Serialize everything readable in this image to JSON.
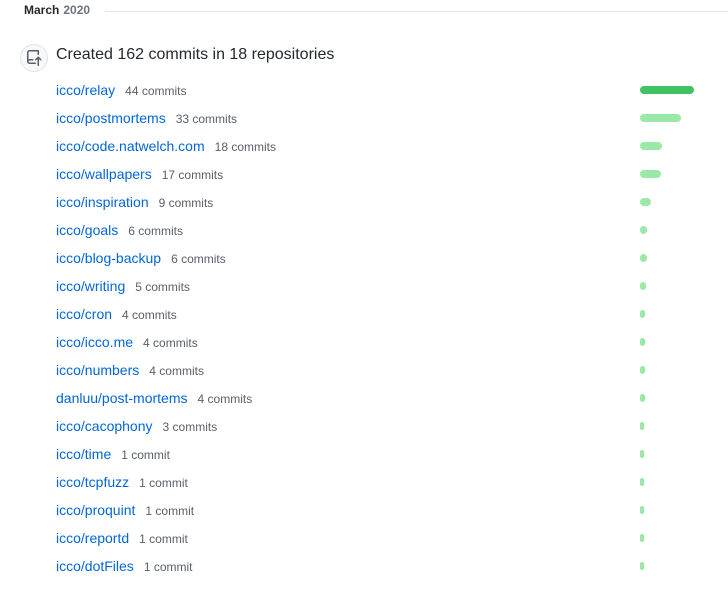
{
  "header": {
    "month": "March",
    "year": "2020"
  },
  "summary": "Created 162 commits in 18 repositories",
  "maxCommits": 44,
  "colors": {
    "high": "#40c463",
    "mid": "#9be9a8",
    "low": "#9be9a8"
  },
  "repos": [
    {
      "name": "icco/relay",
      "commits": 44,
      "label": "44 commits",
      "color": "#40c463"
    },
    {
      "name": "icco/postmortems",
      "commits": 33,
      "label": "33 commits",
      "color": "#9be9a8"
    },
    {
      "name": "icco/code.natwelch.com",
      "commits": 18,
      "label": "18 commits",
      "color": "#9be9a8"
    },
    {
      "name": "icco/wallpapers",
      "commits": 17,
      "label": "17 commits",
      "color": "#9be9a8"
    },
    {
      "name": "icco/inspiration",
      "commits": 9,
      "label": "9 commits",
      "color": "#9be9a8"
    },
    {
      "name": "icco/goals",
      "commits": 6,
      "label": "6 commits",
      "color": "#9be9a8"
    },
    {
      "name": "icco/blog-backup",
      "commits": 6,
      "label": "6 commits",
      "color": "#9be9a8"
    },
    {
      "name": "icco/writing",
      "commits": 5,
      "label": "5 commits",
      "color": "#9be9a8"
    },
    {
      "name": "icco/cron",
      "commits": 4,
      "label": "4 commits",
      "color": "#9be9a8"
    },
    {
      "name": "icco/icco.me",
      "commits": 4,
      "label": "4 commits",
      "color": "#9be9a8"
    },
    {
      "name": "icco/numbers",
      "commits": 4,
      "label": "4 commits",
      "color": "#9be9a8"
    },
    {
      "name": "danluu/post-mortems",
      "commits": 4,
      "label": "4 commits",
      "color": "#9be9a8"
    },
    {
      "name": "icco/cacophony",
      "commits": 3,
      "label": "3 commits",
      "color": "#9be9a8"
    },
    {
      "name": "icco/time",
      "commits": 1,
      "label": "1 commit",
      "color": "#9be9a8"
    },
    {
      "name": "icco/tcpfuzz",
      "commits": 1,
      "label": "1 commit",
      "color": "#9be9a8"
    },
    {
      "name": "icco/proquint",
      "commits": 1,
      "label": "1 commit",
      "color": "#9be9a8"
    },
    {
      "name": "icco/reportd",
      "commits": 1,
      "label": "1 commit",
      "color": "#9be9a8"
    },
    {
      "name": "icco/dotFiles",
      "commits": 1,
      "label": "1 commit",
      "color": "#9be9a8"
    }
  ]
}
